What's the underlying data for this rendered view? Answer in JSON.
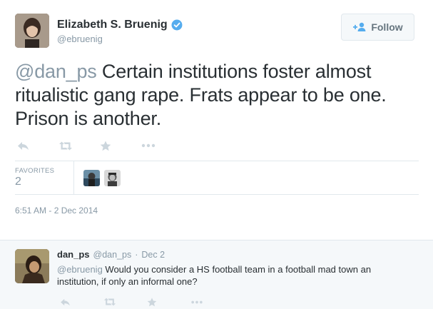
{
  "tweet": {
    "author": {
      "display_name": "Elizabeth S. Bruenig",
      "handle": "@ebruenig",
      "verified": true
    },
    "follow_button": {
      "label": "Follow",
      "icon": "person-add-icon"
    },
    "text": {
      "mention": "@dan_ps",
      "body": " Certain institutions foster almost ritualistic gang rape. Frats appear to be one. Prison is another."
    },
    "actions": [
      "reply-icon",
      "retweet-icon",
      "favorite-star-icon",
      "more-dots-icon"
    ],
    "stats": {
      "favorites_label": "FAVORITES",
      "favorites_count": "2"
    },
    "timestamp": "6:51 AM - 2 Dec 2014"
  },
  "reply": {
    "name": "dan_ps",
    "handle": "@dan_ps",
    "separator": "·",
    "date": "Dec 2",
    "mention": "@ebruenig",
    "body": " Would you consider a HS football team in a football mad town an institution, if only an informal one?",
    "actions": [
      "reply-icon",
      "retweet-icon",
      "favorite-star-icon",
      "more-dots-icon"
    ]
  },
  "colors": {
    "text": "#292f33",
    "muted": "#8899a6",
    "verified": "#55acee",
    "icon": "#ccd6dd",
    "divider": "#e1e8ed",
    "reply_bg": "#f5f8fa"
  }
}
